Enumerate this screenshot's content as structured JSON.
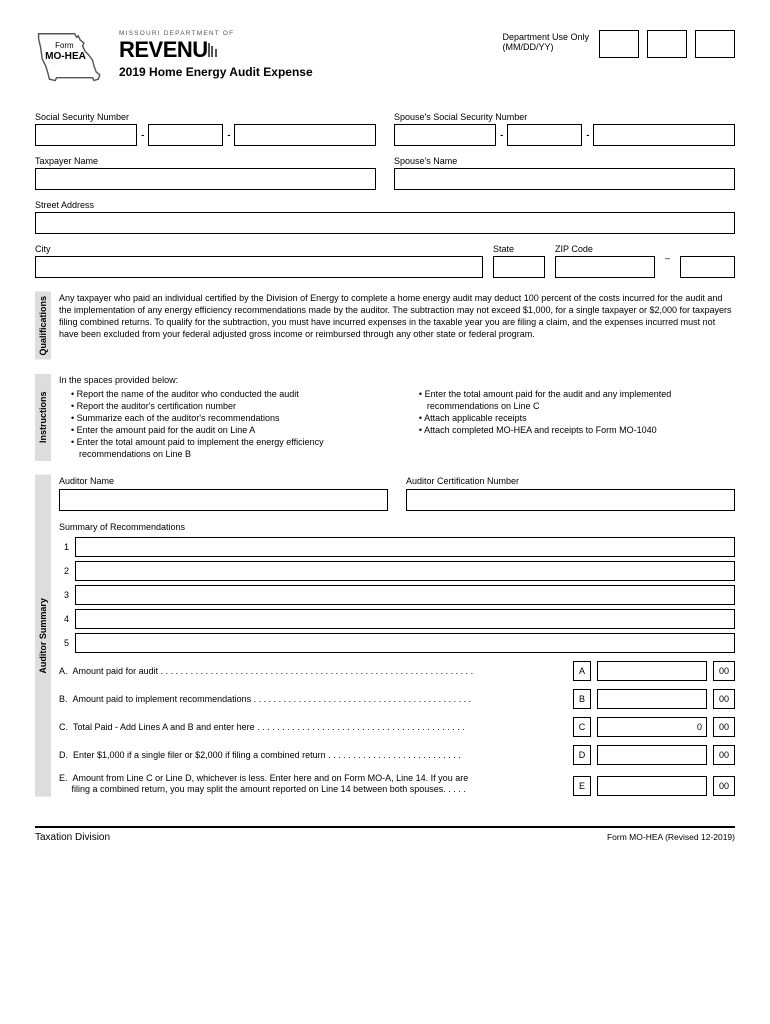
{
  "header": {
    "form_label": "Form",
    "form_code": "MO-HEA",
    "dept_small": "MISSOURI DEPARTMENT OF",
    "logo_text": "REVENU",
    "title": "2019 Home Energy Audit Expense",
    "dept_use": "Department Use Only",
    "dept_use_fmt": "(MM/DD/YY)"
  },
  "personal": {
    "ssn_label": "Social Security Number",
    "spouse_ssn_label": "Spouse's Social Security Number",
    "taxpayer_label": "Taxpayer Name",
    "spouse_name_label": "Spouse's Name",
    "street_label": "Street Address",
    "city_label": "City",
    "state_label": "State",
    "zip_label": "ZIP Code"
  },
  "qualifications": {
    "tab": "Qualifications",
    "text": "Any taxpayer who paid an individual certified by the Division of Energy to complete a home energy audit may deduct 100 percent of the costs incurred for the audit and the implementation of any energy efficiency recommendations made by the auditor. The subtraction may not exceed $1,000, for a single taxpayer or $2,000 for taxpayers filing combined returns. To qualify for the subtraction, you must have incurred expenses in the taxable year you are filing a claim, and the expenses incurred must not have been excluded from your federal adjusted gross income or reimbursed through any other state or federal program."
  },
  "instructions": {
    "tab": "Instructions",
    "intro": "In the spaces provided below:",
    "left": [
      "Report the name of the auditor who conducted the audit",
      "Report the auditor's certification number",
      "Summarize each of the auditor's recommendations",
      "Enter the amount paid for the audit on Line A",
      "Enter the total amount paid to implement the energy efficiency recommendations on Line B"
    ],
    "right": [
      "Enter the total amount paid for the audit and any implemented recommendations on Line C",
      "Attach applicable receipts",
      "Attach completed MO-HEA and receipts to Form MO-1040"
    ]
  },
  "auditor": {
    "tab": "Auditor Summary",
    "name_label": "Auditor Name",
    "cert_label": "Auditor Certification Number",
    "summary_label": "Summary of Recommendations",
    "rows": [
      "1",
      "2",
      "3",
      "4",
      "5"
    ],
    "lines": {
      "A": {
        "letter": "A.",
        "text": "Amount paid for audit",
        "box_letter": "A",
        "value": "",
        "cents": "00"
      },
      "B": {
        "letter": "B.",
        "text": "Amount paid to implement recommendations",
        "box_letter": "B",
        "value": "",
        "cents": "00"
      },
      "C": {
        "letter": "C.",
        "text": "Total Paid - Add Lines A and B and enter here",
        "box_letter": "C",
        "value": "0",
        "cents": "00"
      },
      "D": {
        "letter": "D.",
        "text": "Enter $1,000 if a single filer or $2,000 if filing a combined return",
        "box_letter": "D",
        "value": "",
        "cents": "00"
      },
      "E": {
        "letter": "E.",
        "text1": "Amount from Line C or Line D, whichever is less. Enter here and on Form MO-A, Line 14. If you are",
        "text2": "filing a combined return, you may split the amount reported on Line 14 between both spouses. . . . .",
        "box_letter": "E",
        "value": "",
        "cents": "00"
      }
    }
  },
  "footer": {
    "left": "Taxation Division",
    "right": "Form MO-HEA (Revised 12-2019)"
  }
}
